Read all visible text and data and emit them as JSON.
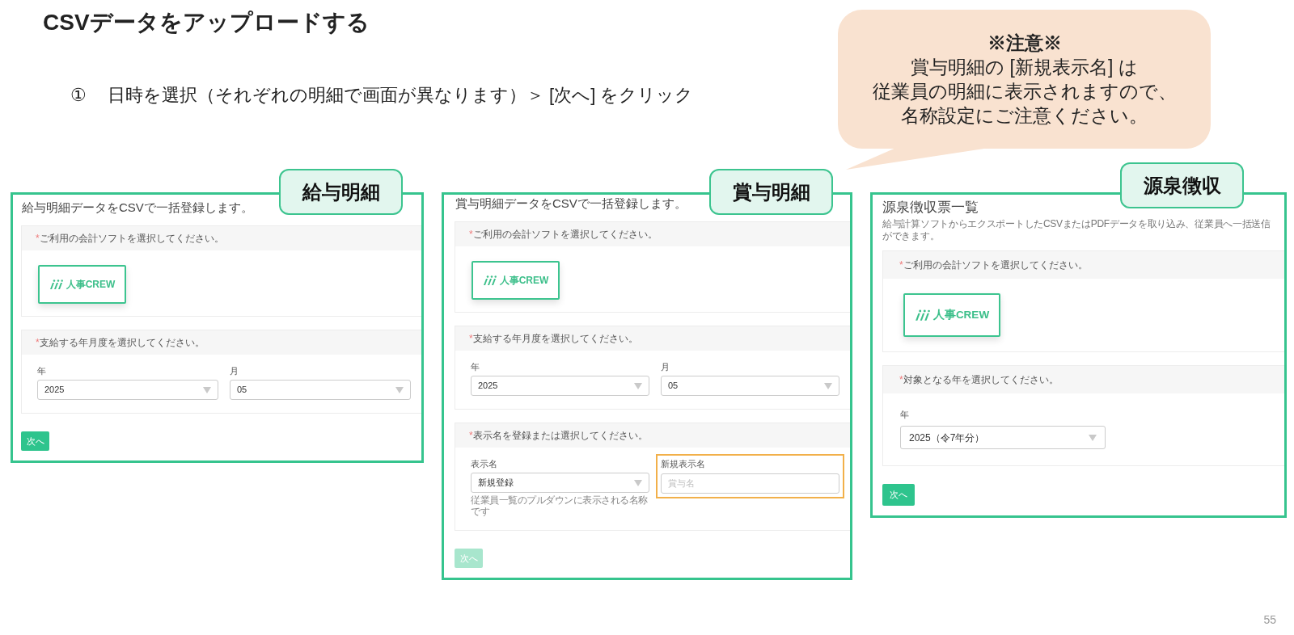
{
  "title": "CSVデータをアップロードする",
  "instruction": {
    "number": "①",
    "text": "日時を選択（それぞれの明細で画面が異なります）＞ [次へ] をクリック"
  },
  "note": {
    "heading": "※注意※",
    "lines": [
      "賞与明細の [新規表示名] は",
      "従業員の明細に表示されますので、",
      "名称設定にご注意ください。"
    ]
  },
  "panels": [
    {
      "tag": "給与明細",
      "heading": "給与明細データをCSVで一括登録します。",
      "sections": [
        {
          "kind": "software",
          "required_mark": "*",
          "label": "ご利用の会計ソフトを選択してください。",
          "logo_text": "人事CREW"
        },
        {
          "kind": "fields",
          "required_mark": "*",
          "label": "支給する年月度を選択してください。",
          "fields": [
            {
              "kind": "select",
              "label": "年",
              "value": "2025",
              "highlighted": false
            },
            {
              "kind": "select",
              "label": "月",
              "value": "05",
              "highlighted": false
            }
          ]
        }
      ],
      "next_button": {
        "label": "次へ",
        "disabled": false
      }
    },
    {
      "tag": "賞与明細",
      "heading": "賞与明細データをCSVで一括登録します。",
      "sections": [
        {
          "kind": "software",
          "required_mark": "*",
          "label": "ご利用の会計ソフトを選択してください。",
          "logo_text": "人事CREW"
        },
        {
          "kind": "fields",
          "required_mark": "*",
          "label": "支給する年月度を選択してください。",
          "fields": [
            {
              "kind": "select",
              "label": "年",
              "value": "2025",
              "highlighted": false
            },
            {
              "kind": "select",
              "label": "月",
              "value": "05",
              "highlighted": false
            }
          ]
        },
        {
          "kind": "fields",
          "required_mark": "*",
          "label": "表示名を登録または選択してください。",
          "fields": [
            {
              "kind": "select",
              "label": "表示名",
              "value": "新規登録",
              "help": "従業員一覧のプルダウンに表示される名称です",
              "highlighted": false
            },
            {
              "kind": "input",
              "label": "新規表示名",
              "placeholder": "賞与名",
              "highlighted": true
            }
          ]
        }
      ],
      "next_button": {
        "label": "次へ",
        "disabled": true
      }
    },
    {
      "tag": "源泉徴収",
      "heading": "源泉徴収票一覧",
      "subtitle": "給与計算ソフトからエクスポートしたCSVまたはPDFデータを取り込み、従業員へ一括送信ができます。",
      "sections": [
        {
          "kind": "software",
          "required_mark": "*",
          "label": "ご利用の会計ソフトを選択してください。",
          "logo_text": "人事CREW"
        },
        {
          "kind": "fields",
          "required_mark": "*",
          "label": "対象となる年を選択してください。",
          "fields": [
            {
              "kind": "select",
              "label": "年",
              "value": "2025（令7年分）",
              "highlighted": false
            }
          ]
        }
      ],
      "next_button": {
        "label": "次へ",
        "disabled": false
      }
    }
  ],
  "page_number": "55"
}
